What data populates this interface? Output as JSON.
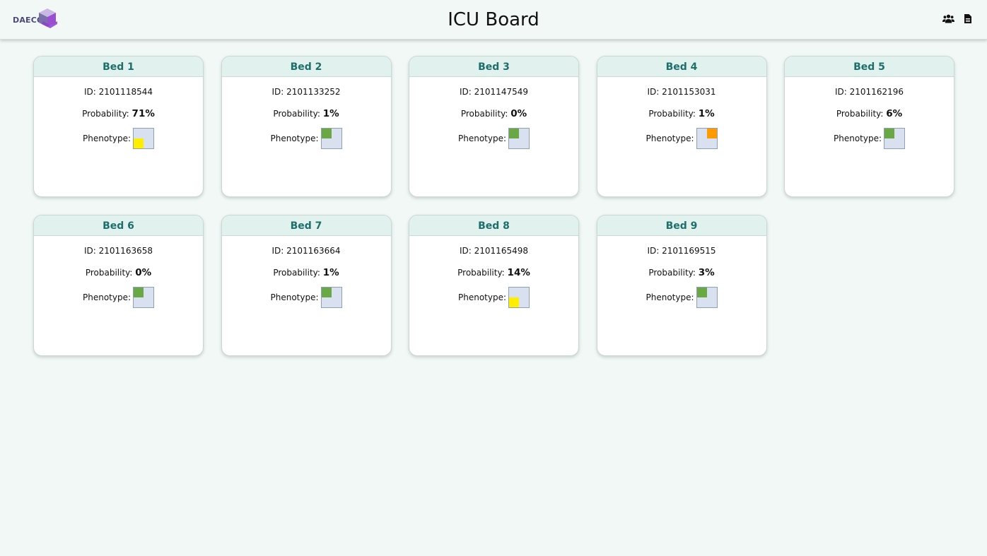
{
  "header": {
    "logo_text": "DAECOS",
    "title": "ICU Board",
    "icons": [
      "users-icon",
      "document-icon"
    ]
  },
  "labels": {
    "id_prefix": "ID: ",
    "probability": "Probability: ",
    "phenotype": "Phenotype: "
  },
  "colors": {
    "accent": "#1e6f6a",
    "header_bg": "#e0f1ee",
    "phenotype_green": "#6aa845",
    "phenotype_yellow": "#ffee00",
    "phenotype_orange": "#ff9a00"
  },
  "beds": [
    {
      "title": "Bed 1",
      "id": "2101118544",
      "probability": "71%",
      "phenotype": {
        "position": "bottom-left",
        "color": "#ffee00"
      }
    },
    {
      "title": "Bed 2",
      "id": "2101133252",
      "probability": "1%",
      "phenotype": {
        "position": "top-left",
        "color": "#6aa845"
      }
    },
    {
      "title": "Bed 3",
      "id": "2101147549",
      "probability": "0%",
      "phenotype": {
        "position": "top-left",
        "color": "#6aa845"
      }
    },
    {
      "title": "Bed 4",
      "id": "2101153031",
      "probability": "1%",
      "phenotype": {
        "position": "top-right",
        "color": "#ff9a00"
      }
    },
    {
      "title": "Bed 5",
      "id": "2101162196",
      "probability": "6%",
      "phenotype": {
        "position": "top-left",
        "color": "#6aa845"
      }
    },
    {
      "title": "Bed 6",
      "id": "2101163658",
      "probability": "0%",
      "phenotype": {
        "position": "top-left",
        "color": "#6aa845"
      }
    },
    {
      "title": "Bed 7",
      "id": "2101163664",
      "probability": "1%",
      "phenotype": {
        "position": "top-left",
        "color": "#6aa845"
      }
    },
    {
      "title": "Bed 8",
      "id": "2101165498",
      "probability": "14%",
      "phenotype": {
        "position": "bottom-left",
        "color": "#ffee00"
      }
    },
    {
      "title": "Bed 9",
      "id": "2101169515",
      "probability": "3%",
      "phenotype": {
        "position": "top-left",
        "color": "#6aa845"
      }
    }
  ]
}
